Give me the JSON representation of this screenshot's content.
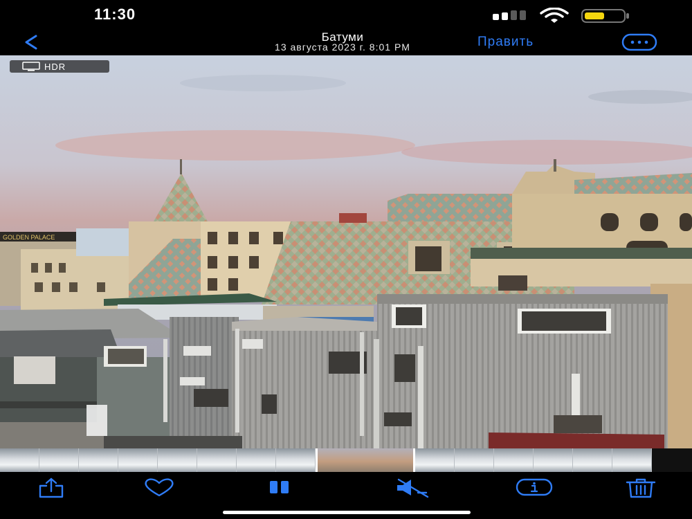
{
  "status_bar": {
    "time": "11:30",
    "icons": [
      "cellular-signal-icon",
      "wifi-icon",
      "battery-icon"
    ],
    "battery_color": "#f5d60f"
  },
  "nav": {
    "back_icon": "chevron-left-icon",
    "city": "Батуми",
    "date": "13 августа 2023 г.  8:01 PM",
    "edit_label": "Править",
    "more_icon": "ellipsis-circle-icon",
    "accent_color": "#2f7cf6"
  },
  "photo": {
    "hdr_icon": "display-icon",
    "hdr_label": "HDR",
    "sign_text": "GOLDEN PALACE"
  },
  "filmstrip": {
    "current_index": 8,
    "thumbnails": [
      "room",
      "room",
      "room",
      "room",
      "room",
      "room",
      "room",
      "room",
      "current",
      "room",
      "room",
      "room",
      "room",
      "room",
      "room"
    ]
  },
  "toolbar": {
    "items": [
      {
        "name": "share",
        "icon": "share-icon"
      },
      {
        "name": "favorite",
        "icon": "heart-icon"
      },
      {
        "name": "pause",
        "icon": "pause-icon"
      },
      {
        "name": "mute",
        "icon": "speaker-muted-icon"
      },
      {
        "name": "info",
        "icon": "info-icon"
      },
      {
        "name": "delete",
        "icon": "trash-icon"
      }
    ]
  }
}
